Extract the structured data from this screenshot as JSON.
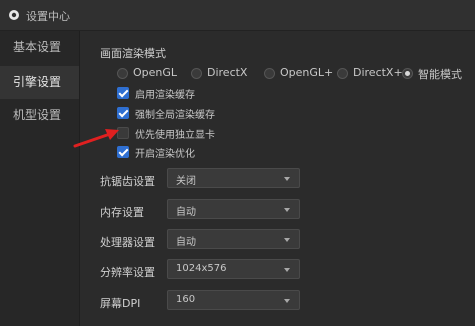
{
  "window": {
    "title": "设置中心"
  },
  "sidebar": {
    "items": [
      {
        "label": "基本设置",
        "active": false
      },
      {
        "label": "引擎设置",
        "active": true
      },
      {
        "label": "机型设置",
        "active": false
      }
    ]
  },
  "render": {
    "section_title": "画面渲染模式",
    "modes": [
      {
        "label": "OpenGL",
        "selected": false
      },
      {
        "label": "DirectX",
        "selected": false
      },
      {
        "label": "OpenGL+",
        "selected": false
      },
      {
        "label": "DirectX+",
        "selected": false
      },
      {
        "label": "智能模式",
        "selected": true
      }
    ],
    "options": [
      {
        "label": "启用渲染缓存",
        "checked": true
      },
      {
        "label": "强制全局渲染缓存",
        "checked": true
      },
      {
        "label": "优先使用独立显卡",
        "checked": false
      },
      {
        "label": "开启渲染优化",
        "checked": true
      }
    ]
  },
  "settings": [
    {
      "label": "抗锯齿设置",
      "value": "关闭"
    },
    {
      "label": "内存设置",
      "value": "自动"
    },
    {
      "label": "处理器设置",
      "value": "自动"
    },
    {
      "label": "分辨率设置",
      "value": "1024x576"
    },
    {
      "label": "屏幕DPI",
      "value": "160"
    }
  ],
  "colors": {
    "accent": "#2f6fd1",
    "annotation_arrow": "#e02020"
  }
}
